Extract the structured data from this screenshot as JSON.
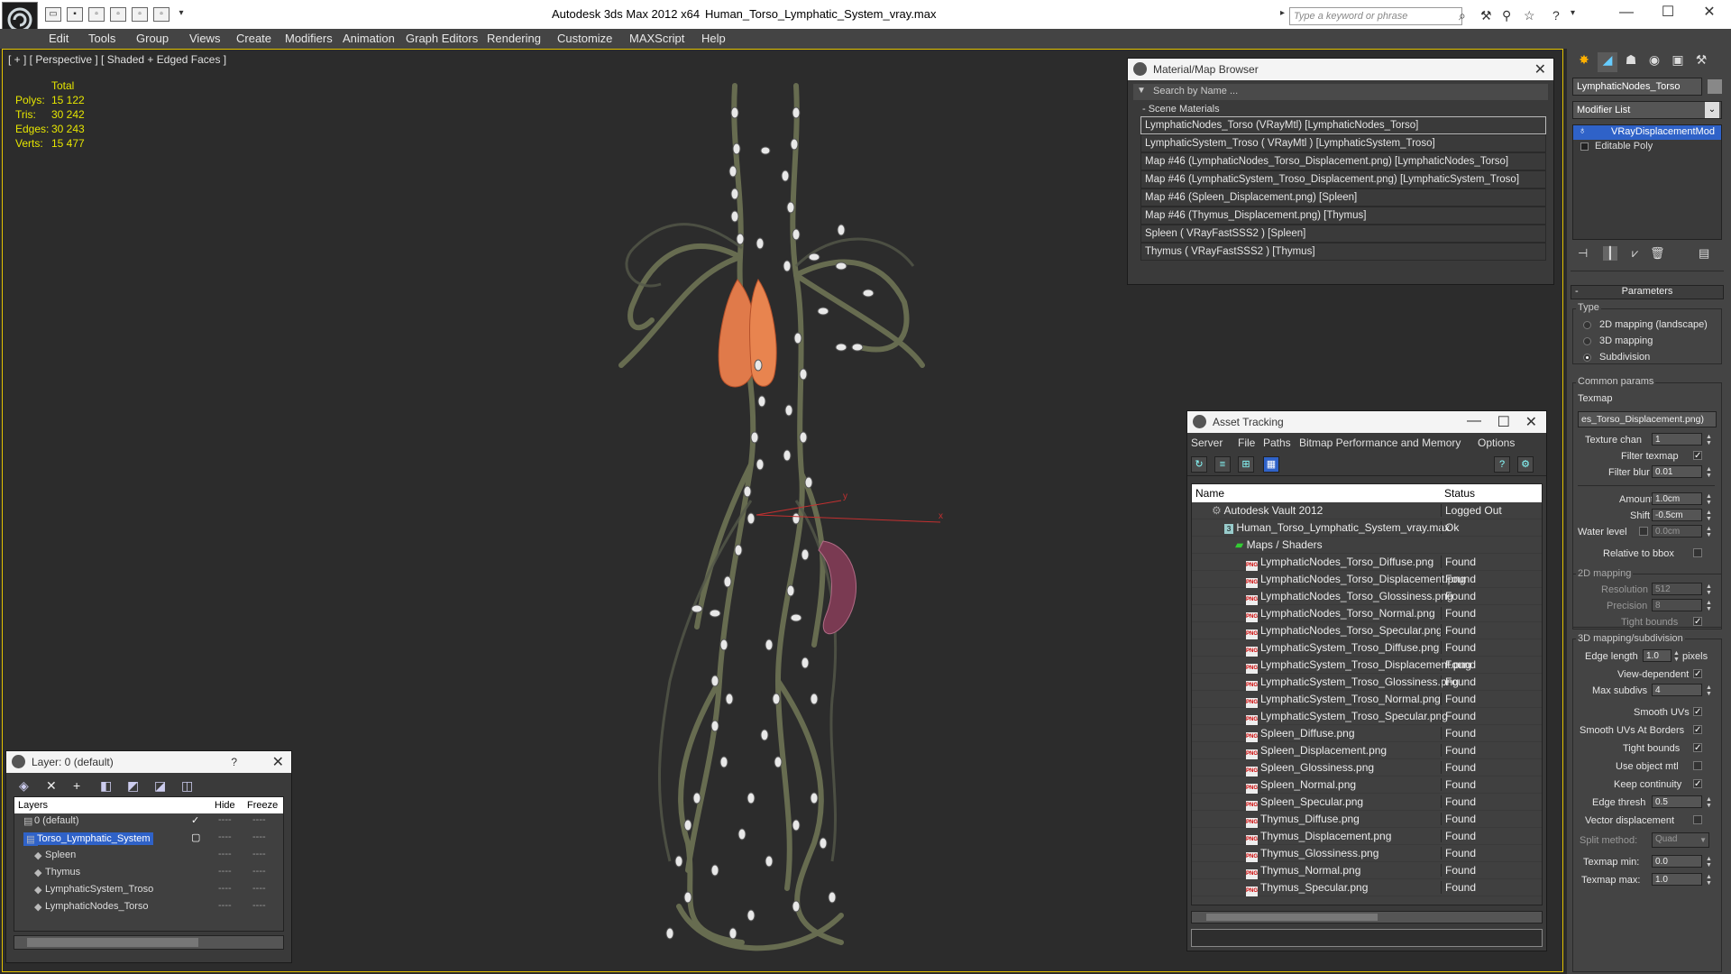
{
  "titlebar": {
    "app_title": "Autodesk 3ds Max  2012 x64",
    "file_name": "Human_Torso_Lymphatic_System_vray.max",
    "search_placeholder": "Type a keyword or phrase"
  },
  "menu": [
    "Edit",
    "Tools",
    "Group",
    "Views",
    "Create",
    "Modifiers",
    "Animation",
    "Graph Editors",
    "Rendering",
    "Customize",
    "MAXScript",
    "Help"
  ],
  "viewport": {
    "label": "[ + ] [ Perspective ] [ Shaded + Edged Faces ]",
    "stats_header": "Total",
    "stats": [
      {
        "label": "Polys:",
        "value": "15 122"
      },
      {
        "label": "Tris:",
        "value": "30 242"
      },
      {
        "label": "Edges:",
        "value": "30 243"
      },
      {
        "label": "Verts:",
        "value": "15 477"
      }
    ],
    "axis_x": "x",
    "axis_y": "y"
  },
  "material_browser": {
    "title": "Material/Map Browser",
    "search_placeholder": "Search by Name ...",
    "group": "- Scene Materials",
    "items": [
      "LymphaticNodes_Torso  (VRayMtl)  [LymphaticNodes_Torso]",
      "LymphaticSystem_Troso  ( VRayMtl )  [LymphaticSystem_Troso]",
      "Map #46 (LymphaticNodes_Torso_Displacement.png)  [LymphaticNodes_Torso]",
      "Map #46 (LymphaticSystem_Troso_Displacement.png)  [LymphaticSystem_Troso]",
      "Map #46 (Spleen_Displacement.png)  [Spleen]",
      "Map #46 (Thymus_Displacement.png)  [Thymus]",
      "Spleen  ( VRayFastSSS2 )  [Spleen]",
      "Thymus  ( VRayFastSSS2 )  [Thymus]"
    ]
  },
  "asset_tracking": {
    "title": "Asset Tracking",
    "menu": [
      "Server",
      "File",
      "Paths",
      "Bitmap Performance and Memory",
      "Options"
    ],
    "col_name": "Name",
    "col_status": "Status",
    "vault": {
      "name": "Autodesk Vault 2012",
      "status": "Logged Out"
    },
    "file": {
      "name": "Human_Torso_Lymphatic_System_vray.max",
      "status": "Ok"
    },
    "folder": {
      "name": "Maps / Shaders",
      "status": ""
    },
    "png_tag": "PNG",
    "maps": [
      {
        "name": "LymphaticNodes_Torso_Diffuse.png",
        "status": "Found"
      },
      {
        "name": "LymphaticNodes_Torso_Displacement.png",
        "status": "Found"
      },
      {
        "name": "LymphaticNodes_Torso_Glossiness.png",
        "status": "Found"
      },
      {
        "name": "LymphaticNodes_Torso_Normal.png",
        "status": "Found"
      },
      {
        "name": "LymphaticNodes_Torso_Specular.png",
        "status": "Found"
      },
      {
        "name": "LymphaticSystem_Troso_Diffuse.png",
        "status": "Found"
      },
      {
        "name": "LymphaticSystem_Troso_Displacement.png",
        "status": "Found"
      },
      {
        "name": "LymphaticSystem_Troso_Glossiness.png",
        "status": "Found"
      },
      {
        "name": "LymphaticSystem_Troso_Normal.png",
        "status": "Found"
      },
      {
        "name": "LymphaticSystem_Troso_Specular.png",
        "status": "Found"
      },
      {
        "name": "Spleen_Diffuse.png",
        "status": "Found"
      },
      {
        "name": "Spleen_Displacement.png",
        "status": "Found"
      },
      {
        "name": "Spleen_Glossiness.png",
        "status": "Found"
      },
      {
        "name": "Spleen_Normal.png",
        "status": "Found"
      },
      {
        "name": "Spleen_Specular.png",
        "status": "Found"
      },
      {
        "name": "Thymus_Diffuse.png",
        "status": "Found"
      },
      {
        "name": "Thymus_Displacement.png",
        "status": "Found"
      },
      {
        "name": "Thymus_Glossiness.png",
        "status": "Found"
      },
      {
        "name": "Thymus_Normal.png",
        "status": "Found"
      },
      {
        "name": "Thymus_Specular.png",
        "status": "Found"
      }
    ]
  },
  "layer_window": {
    "title": "Layer: 0 (default)",
    "help": "?",
    "col_layers": "Layers",
    "col_hide": "Hide",
    "col_freeze": "Freeze",
    "rows": [
      "0 (default)",
      "Torso_Lymphatic_System",
      "Spleen",
      "Thymus",
      "LymphaticSystem_Troso",
      "LymphaticNodes_Torso"
    ]
  },
  "command_panel": {
    "object_name": "LymphaticNodes_Torso",
    "modifier_list": "Modifier List",
    "stack": [
      "VRayDisplacementMod",
      "Editable Poly"
    ],
    "params_title": "Parameters",
    "type_label": "Type",
    "type_options": [
      "2D mapping (landscape)",
      "3D mapping",
      "Subdivision"
    ],
    "type_selected": "Subdivision",
    "common_params": "Common params",
    "texmap_label": "Texmap",
    "texmap_value": "es_Torso_Displacement.png)",
    "texture_chan_label": "Texture chan",
    "texture_chan": "1",
    "filter_texmap": "Filter texmap",
    "filter_blur_label": "Filter blur",
    "filter_blur": "0.01",
    "amount_label": "Amount",
    "amount": "1.0cm",
    "shift_label": "Shift",
    "shift": "-0.5cm",
    "water_level_label": "Water level",
    "water_level": "0.0cm",
    "relative_bbox": "Relative to bbox",
    "mapping2d_title": "2D mapping",
    "resolution_label": "Resolution",
    "resolution": "512",
    "precision_label": "Precision",
    "precision": "8",
    "tight_bounds_2d": "Tight bounds",
    "mapping3d_title": "3D mapping/subdivision",
    "edge_length_label": "Edge length",
    "edge_length": "1.0",
    "pixels": "pixels",
    "view_dependent": "View-dependent",
    "max_subdivs_label": "Max subdivs",
    "max_subdivs": "4",
    "smooth_uvs": "Smooth UVs",
    "smooth_uvs_borders": "Smooth UVs At Borders",
    "tight_bounds": "Tight bounds",
    "use_object_mtl": "Use object mtl",
    "keep_continuity": "Keep continuity",
    "edge_thresh_label": "Edge thresh",
    "edge_thresh": "0.5",
    "vector_displacement": "Vector displacement",
    "split_method_label": "Split method:",
    "split_method": "Quad",
    "texmap_min_label": "Texmap min:",
    "texmap_min": "0.0",
    "texmap_max_label": "Texmap max:",
    "texmap_max": "1.0",
    "check_mark": "✓"
  }
}
